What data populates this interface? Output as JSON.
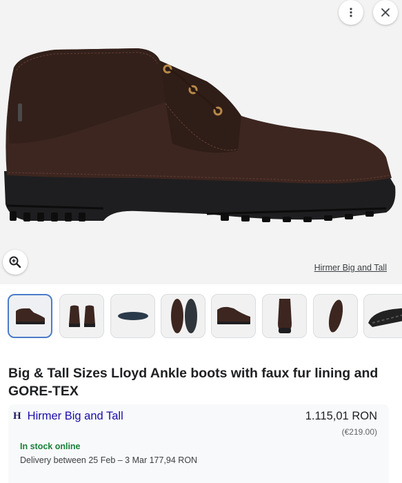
{
  "viewer": {
    "icons": {
      "more": "more-vert-icon",
      "close": "close-icon",
      "zoom": "zoom-in-icon"
    },
    "source_label": "Hirmer Big and Tall"
  },
  "thumbnails": [
    {
      "view": "side",
      "selected": true
    },
    {
      "view": "back-pair"
    },
    {
      "view": "sole-side"
    },
    {
      "view": "top-pair"
    },
    {
      "view": "side-angle"
    },
    {
      "view": "front"
    },
    {
      "view": "top-single"
    },
    {
      "view": "outsole"
    }
  ],
  "product": {
    "title": "Big & Tall Sizes Lloyd Ankle boots with faux fur lining and GORE-TEX"
  },
  "offer": {
    "merchant_logo": "H",
    "merchant": "Hirmer Big and Tall",
    "price": "1.115,01 RON",
    "price_original": "(€219.00)",
    "stock": "In stock online",
    "delivery": "Delivery between 25 Feb – 3 Mar 177,94 RON",
    "colors": {
      "stock": "#188038",
      "link": "#1a0dab",
      "selected_border": "#4a7cc9"
    }
  }
}
